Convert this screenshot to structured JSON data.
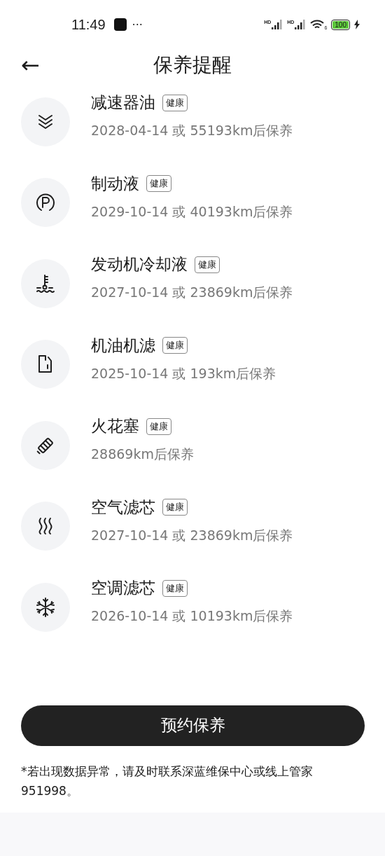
{
  "status_bar": {
    "time": "11:49",
    "more": "···",
    "signals": [
      {
        "label": "HD"
      },
      {
        "label": "HD"
      }
    ],
    "wifi_label": "6",
    "battery": "100"
  },
  "header": {
    "back": "←",
    "title": "保养提醒"
  },
  "items": [
    {
      "name": "减速器油",
      "badge": "健康",
      "due": "2028-04-14 或 55193km后保养"
    },
    {
      "name": "制动液",
      "badge": "健康",
      "due": "2029-10-14 或 40193km后保养"
    },
    {
      "name": "发动机冷却液",
      "badge": "健康",
      "due": "2027-10-14 或 23869km后保养"
    },
    {
      "name": "机油机滤",
      "badge": "健康",
      "due": "2025-10-14 或 193km后保养"
    },
    {
      "name": "火花塞",
      "badge": "健康",
      "due": "28869km后保养"
    },
    {
      "name": "空气滤芯",
      "badge": "健康",
      "due": "2027-10-14 或 23869km后保养"
    },
    {
      "name": "空调滤芯",
      "badge": "健康",
      "due": "2026-10-14 或 10193km后保养"
    }
  ],
  "book_button": "预约保养",
  "note": "*若出现数据异常，请及时联系深蓝维保中心或线上管家951998。"
}
